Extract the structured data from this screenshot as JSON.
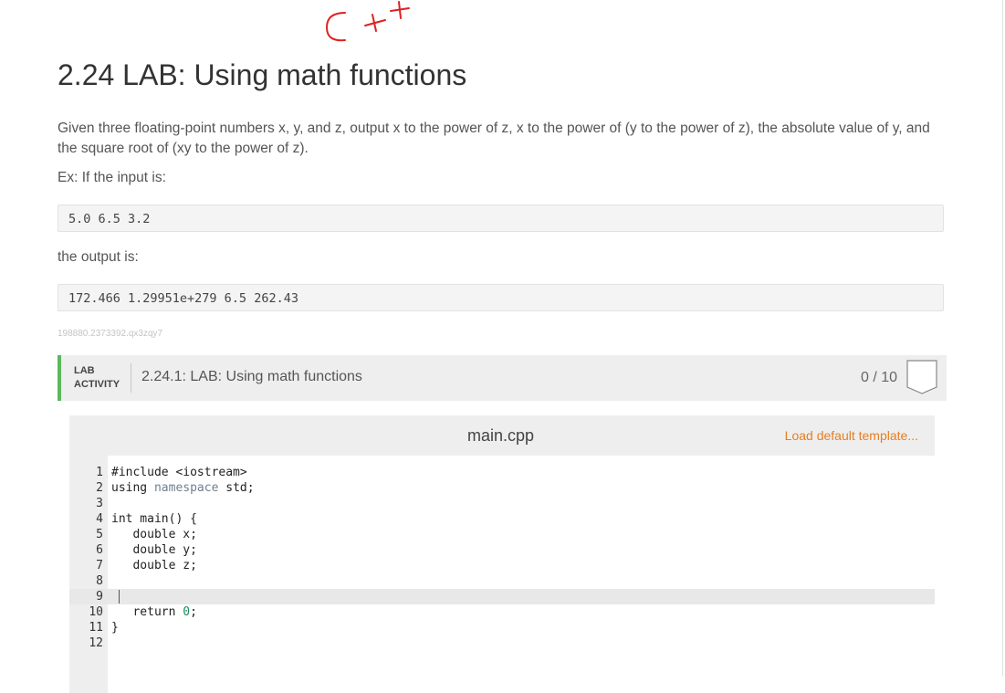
{
  "annotation": {
    "handwritten_text": "C++"
  },
  "page": {
    "title": "2.24 LAB: Using math functions",
    "description": "Given three floating-point numbers x, y, and z, output x to the power of z, x to the power of (y to the power of z), the absolute value of y, and the square root of (xy to the power of z).",
    "example_intro": "Ex: If the input is:",
    "example_input": "5.0 6.5 3.2",
    "output_intro": "the output is:",
    "example_output": "172.466 1.29951e+279 6.5 262.43",
    "tiny_id": "198880.2373392.qx3zqy7"
  },
  "lab": {
    "tag_line1": "LAB",
    "tag_line2": "ACTIVITY",
    "name": "2.24.1: LAB: Using math functions",
    "score": "0 / 10",
    "accent_color": "#5cb85c"
  },
  "editor": {
    "file_name": "main.cpp",
    "load_default_label": "Load default template...",
    "active_line": 9,
    "lines": [
      {
        "num": "1",
        "pre": "#include <iostream>",
        "ns": "",
        "post": "",
        "numlit": ""
      },
      {
        "num": "2",
        "pre": "using ",
        "ns": "namespace",
        "post": " std;",
        "numlit": ""
      },
      {
        "num": "3",
        "pre": "",
        "ns": "",
        "post": "",
        "numlit": ""
      },
      {
        "num": "4",
        "pre": "int main() {",
        "ns": "",
        "post": "",
        "numlit": ""
      },
      {
        "num": "5",
        "pre": "   double x;",
        "ns": "",
        "post": "",
        "numlit": ""
      },
      {
        "num": "6",
        "pre": "   double y;",
        "ns": "",
        "post": "",
        "numlit": ""
      },
      {
        "num": "7",
        "pre": "   double z;",
        "ns": "",
        "post": "",
        "numlit": ""
      },
      {
        "num": "8",
        "pre": "",
        "ns": "",
        "post": "",
        "numlit": ""
      },
      {
        "num": "9",
        "pre": "",
        "ns": "",
        "post": "",
        "numlit": ""
      },
      {
        "num": "10",
        "pre": "   return ",
        "ns": "",
        "post": ";",
        "numlit": "0"
      },
      {
        "num": "11",
        "pre": "}",
        "ns": "",
        "post": "",
        "numlit": ""
      },
      {
        "num": "12",
        "pre": "",
        "ns": "",
        "post": "",
        "numlit": ""
      }
    ]
  }
}
